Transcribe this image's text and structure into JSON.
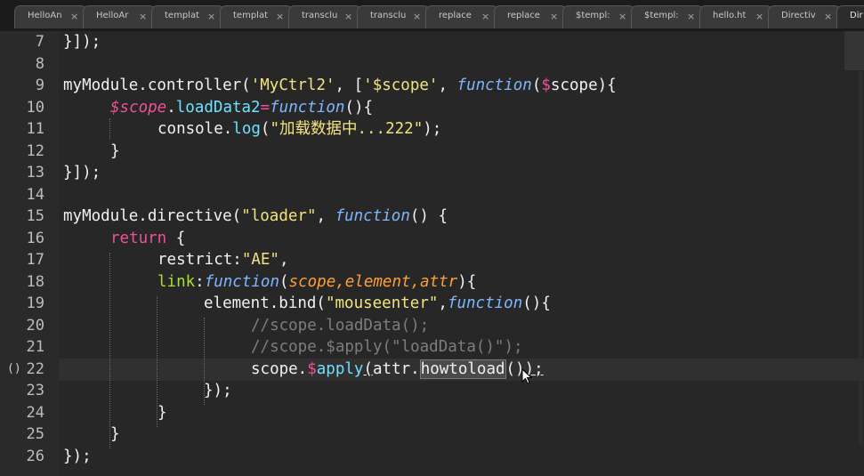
{
  "tabs": [
    {
      "label": "HelloAn",
      "close": "×"
    },
    {
      "label": "HelloAr",
      "close": "×"
    },
    {
      "label": "templat",
      "close": "×"
    },
    {
      "label": "templat",
      "close": "×"
    },
    {
      "label": "transclu",
      "close": "×"
    },
    {
      "label": "transclu",
      "close": "×"
    },
    {
      "label": "replace",
      "close": "×"
    },
    {
      "label": "replace",
      "close": "×"
    },
    {
      "label": "$templ:",
      "close": "×"
    },
    {
      "label": "$templ:",
      "close": "×"
    },
    {
      "label": "hello.ht",
      "close": "×"
    },
    {
      "label": "Directiv",
      "close": "×"
    },
    {
      "label": "Dir",
      "close": ""
    }
  ],
  "editor": {
    "line_numbers": [
      "7",
      "8",
      "9",
      "10",
      "11",
      "12",
      "13",
      "14",
      "15",
      "16",
      "17",
      "18",
      "19",
      "20",
      "21",
      "22",
      "23",
      "24",
      "25",
      "26"
    ],
    "current_line": "22",
    "fold_marker": "()",
    "code": {
      "l7": [
        "}]);"
      ],
      "l9": [
        "myModule.controller(",
        "'MyCtrl2'",
        ", [",
        "'$scope'",
        ", ",
        "function",
        "(",
        "$",
        "scope){"
      ],
      "l10": [
        "$scope",
        ".",
        "loadData2",
        "=",
        "function",
        "(){"
      ],
      "l11": [
        "console.",
        "log",
        "(",
        "\"加载数据中...222\"",
        ");"
      ],
      "l12": [
        "}"
      ],
      "l13": [
        "}]);"
      ],
      "l15": [
        "myModule.directive(",
        "\"loader\"",
        ", ",
        "function",
        "() {"
      ],
      "l16": [
        "return",
        " {"
      ],
      "l17": [
        "restrict:",
        "\"AE\"",
        ","
      ],
      "l18": [
        "link",
        ":",
        "function",
        "(",
        "scope,element,attr",
        "){"
      ],
      "l19": [
        "element.bind(",
        "\"mouseenter\"",
        ",",
        "function",
        "(){"
      ],
      "l20": [
        "//scope.loadData();"
      ],
      "l21": [
        "//scope.$apply(\"loadData()\");"
      ],
      "l22": [
        "scope.",
        "$",
        "apply",
        "(",
        "attr.",
        "howtoload",
        "()",
        ");"
      ],
      "l23": [
        "});"
      ],
      "l24": [
        "}"
      ],
      "l25": [
        "}"
      ],
      "l26": [
        "});"
      ]
    }
  },
  "colors": {
    "keyword": "#f0509a",
    "function": "#7eb6ff",
    "string": "#f3e380",
    "param": "#ff9f3a",
    "comment": "#7d7d7d",
    "background": "#272727"
  }
}
